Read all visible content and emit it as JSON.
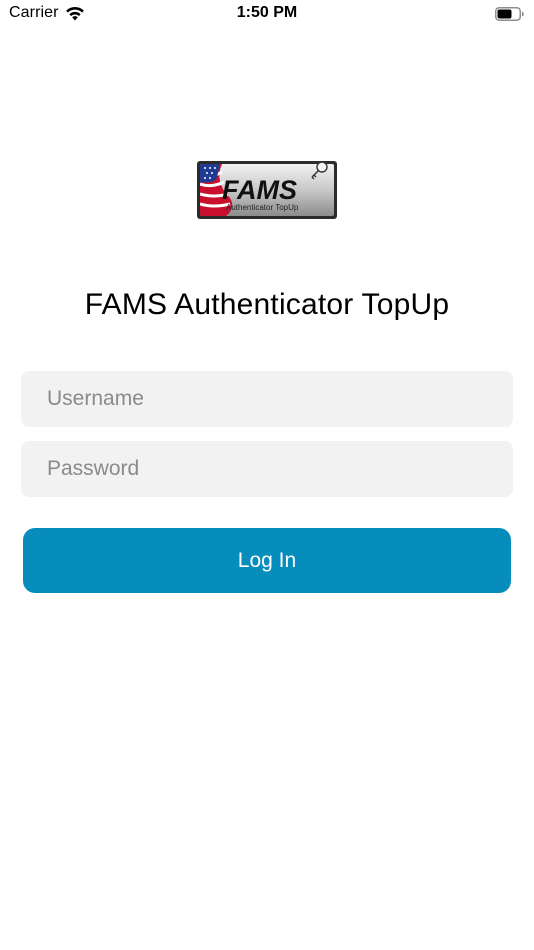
{
  "status_bar": {
    "carrier": "Carrier",
    "time": "1:50 PM"
  },
  "logo": {
    "wordmark": "FAMS",
    "tagline": "Authenticator TopUp"
  },
  "app_title": "FAMS Authenticator TopUp",
  "form": {
    "username_placeholder": "Username",
    "password_placeholder": "Password",
    "login_label": "Log In"
  },
  "colors": {
    "accent": "#068dbc",
    "field_background": "#f2f2f2",
    "placeholder_text": "#8a8a8e"
  }
}
